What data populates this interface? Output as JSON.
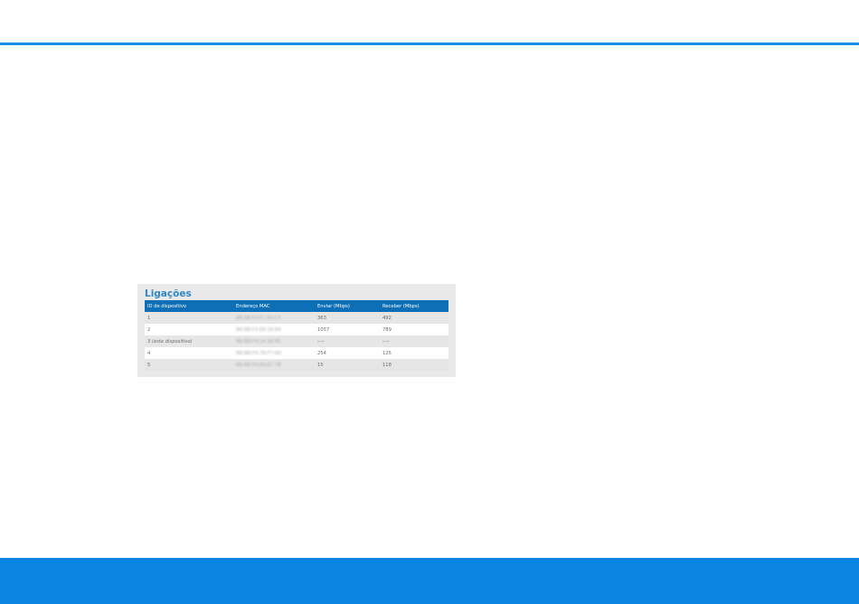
{
  "connections": {
    "title": "Ligações",
    "headers": {
      "device_id": "ID de dispositivo",
      "mac": "Endereço MAC",
      "send": "Enviar (Mbps)",
      "receive": "Receber (Mbps)"
    },
    "rows": [
      {
        "id": "1",
        "note": "",
        "mac": "BB:BB:F4:FC:80:C5",
        "send": "363",
        "receive": "492"
      },
      {
        "id": "2",
        "note": "",
        "mac": "BB:BB:F4:DE:1E:B4",
        "send": "1057",
        "receive": "789"
      },
      {
        "id": "3",
        "note": "(este dispositivo)",
        "mac": "BB:BB:F4:1A:2E:B5",
        "send": "----",
        "receive": "----"
      },
      {
        "id": "4",
        "note": "",
        "mac": "BB:BB:F4:7B:F7:AD",
        "send": "254",
        "receive": "125"
      },
      {
        "id": "5",
        "note": "",
        "mac": "BB:BB:F4:8A:EC:7B",
        "send": "15",
        "receive": "118"
      }
    ]
  },
  "colors": {
    "accent": "#1e8fe6",
    "header": "#0e6fb6",
    "title": "#2f86c9",
    "footer": "#0a86e0"
  }
}
